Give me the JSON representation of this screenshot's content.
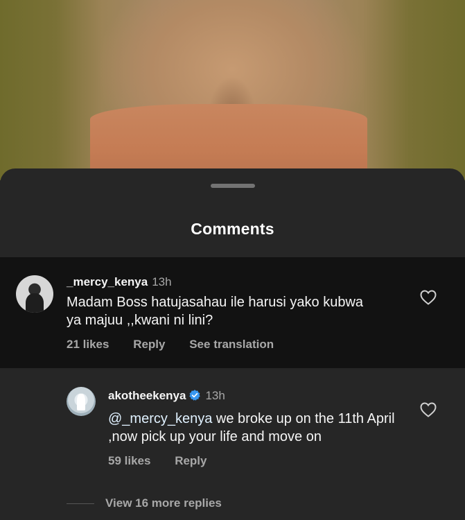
{
  "sheet": {
    "title": "Comments"
  },
  "comments": [
    {
      "username": "_mercy_kenya",
      "time": "13h",
      "text": "Madam Boss hatujasahau ile harusi yako kubwa ya majuu ,,kwani ni lini?",
      "likes": "21 likes",
      "reply": "Reply",
      "translate": "See translation"
    }
  ],
  "replies": [
    {
      "username": "akotheekenya",
      "verified": true,
      "time": "13h",
      "mention": "@_mercy_kenya",
      "text": " we broke up on the 11th April ,now pick up your life and move on",
      "likes": "59 likes",
      "reply": "Reply"
    }
  ],
  "view_more": "View 16 more replies",
  "colors": {
    "sheet_bg": "#262626",
    "comment_bg": "#121212",
    "verified": "#3897f0"
  }
}
